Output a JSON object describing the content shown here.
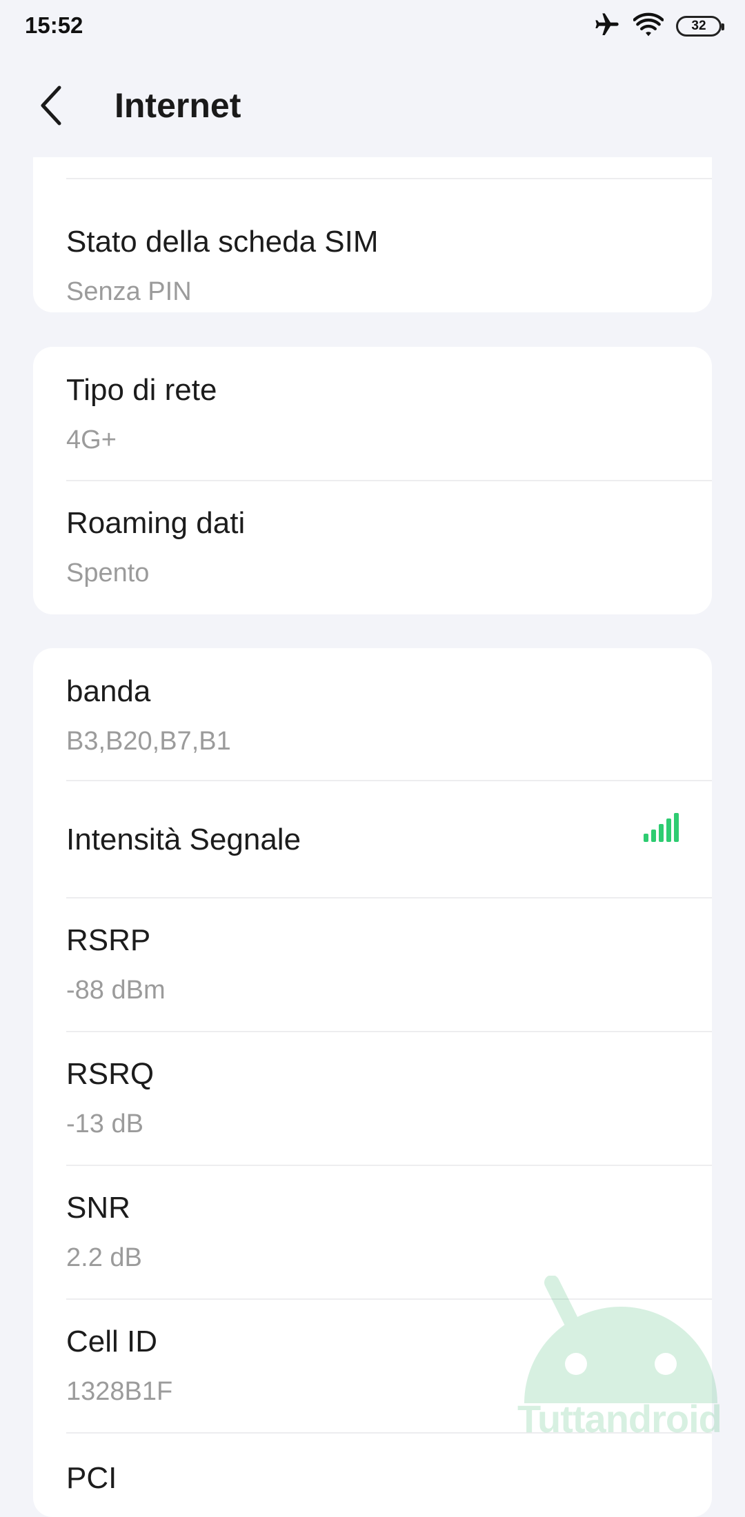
{
  "status_bar": {
    "time": "15:52",
    "battery": "32",
    "icons": [
      "airplane-icon",
      "wifi-icon",
      "battery-icon"
    ]
  },
  "app_bar": {
    "title": "Internet",
    "back_icon": "chevron-left-icon"
  },
  "cards": [
    {
      "items": [
        {
          "title": "Stato della scheda SIM",
          "value": "Senza PIN"
        }
      ]
    },
    {
      "items": [
        {
          "title": "Tipo di rete",
          "value": "4G+"
        },
        {
          "title": "Roaming dati",
          "value": "Spento"
        }
      ]
    },
    {
      "items": [
        {
          "title": "banda",
          "value": "B3,B20,B7,B1"
        },
        {
          "title": "Intensità Segnale",
          "signal_bars": 5,
          "signal_level": 5,
          "signal_color": "#2ecc71"
        },
        {
          "title": "RSRP",
          "value": "-88 dBm"
        },
        {
          "title": "RSRQ",
          "value": "-13 dB"
        },
        {
          "title": "SNR",
          "value": "2.2 dB"
        },
        {
          "title": "Cell ID",
          "value": "1328B1F"
        },
        {
          "title": "PCI",
          "value": ""
        }
      ]
    }
  ],
  "watermark": {
    "text": "Tuttandroid",
    "color": "#27ae60"
  }
}
